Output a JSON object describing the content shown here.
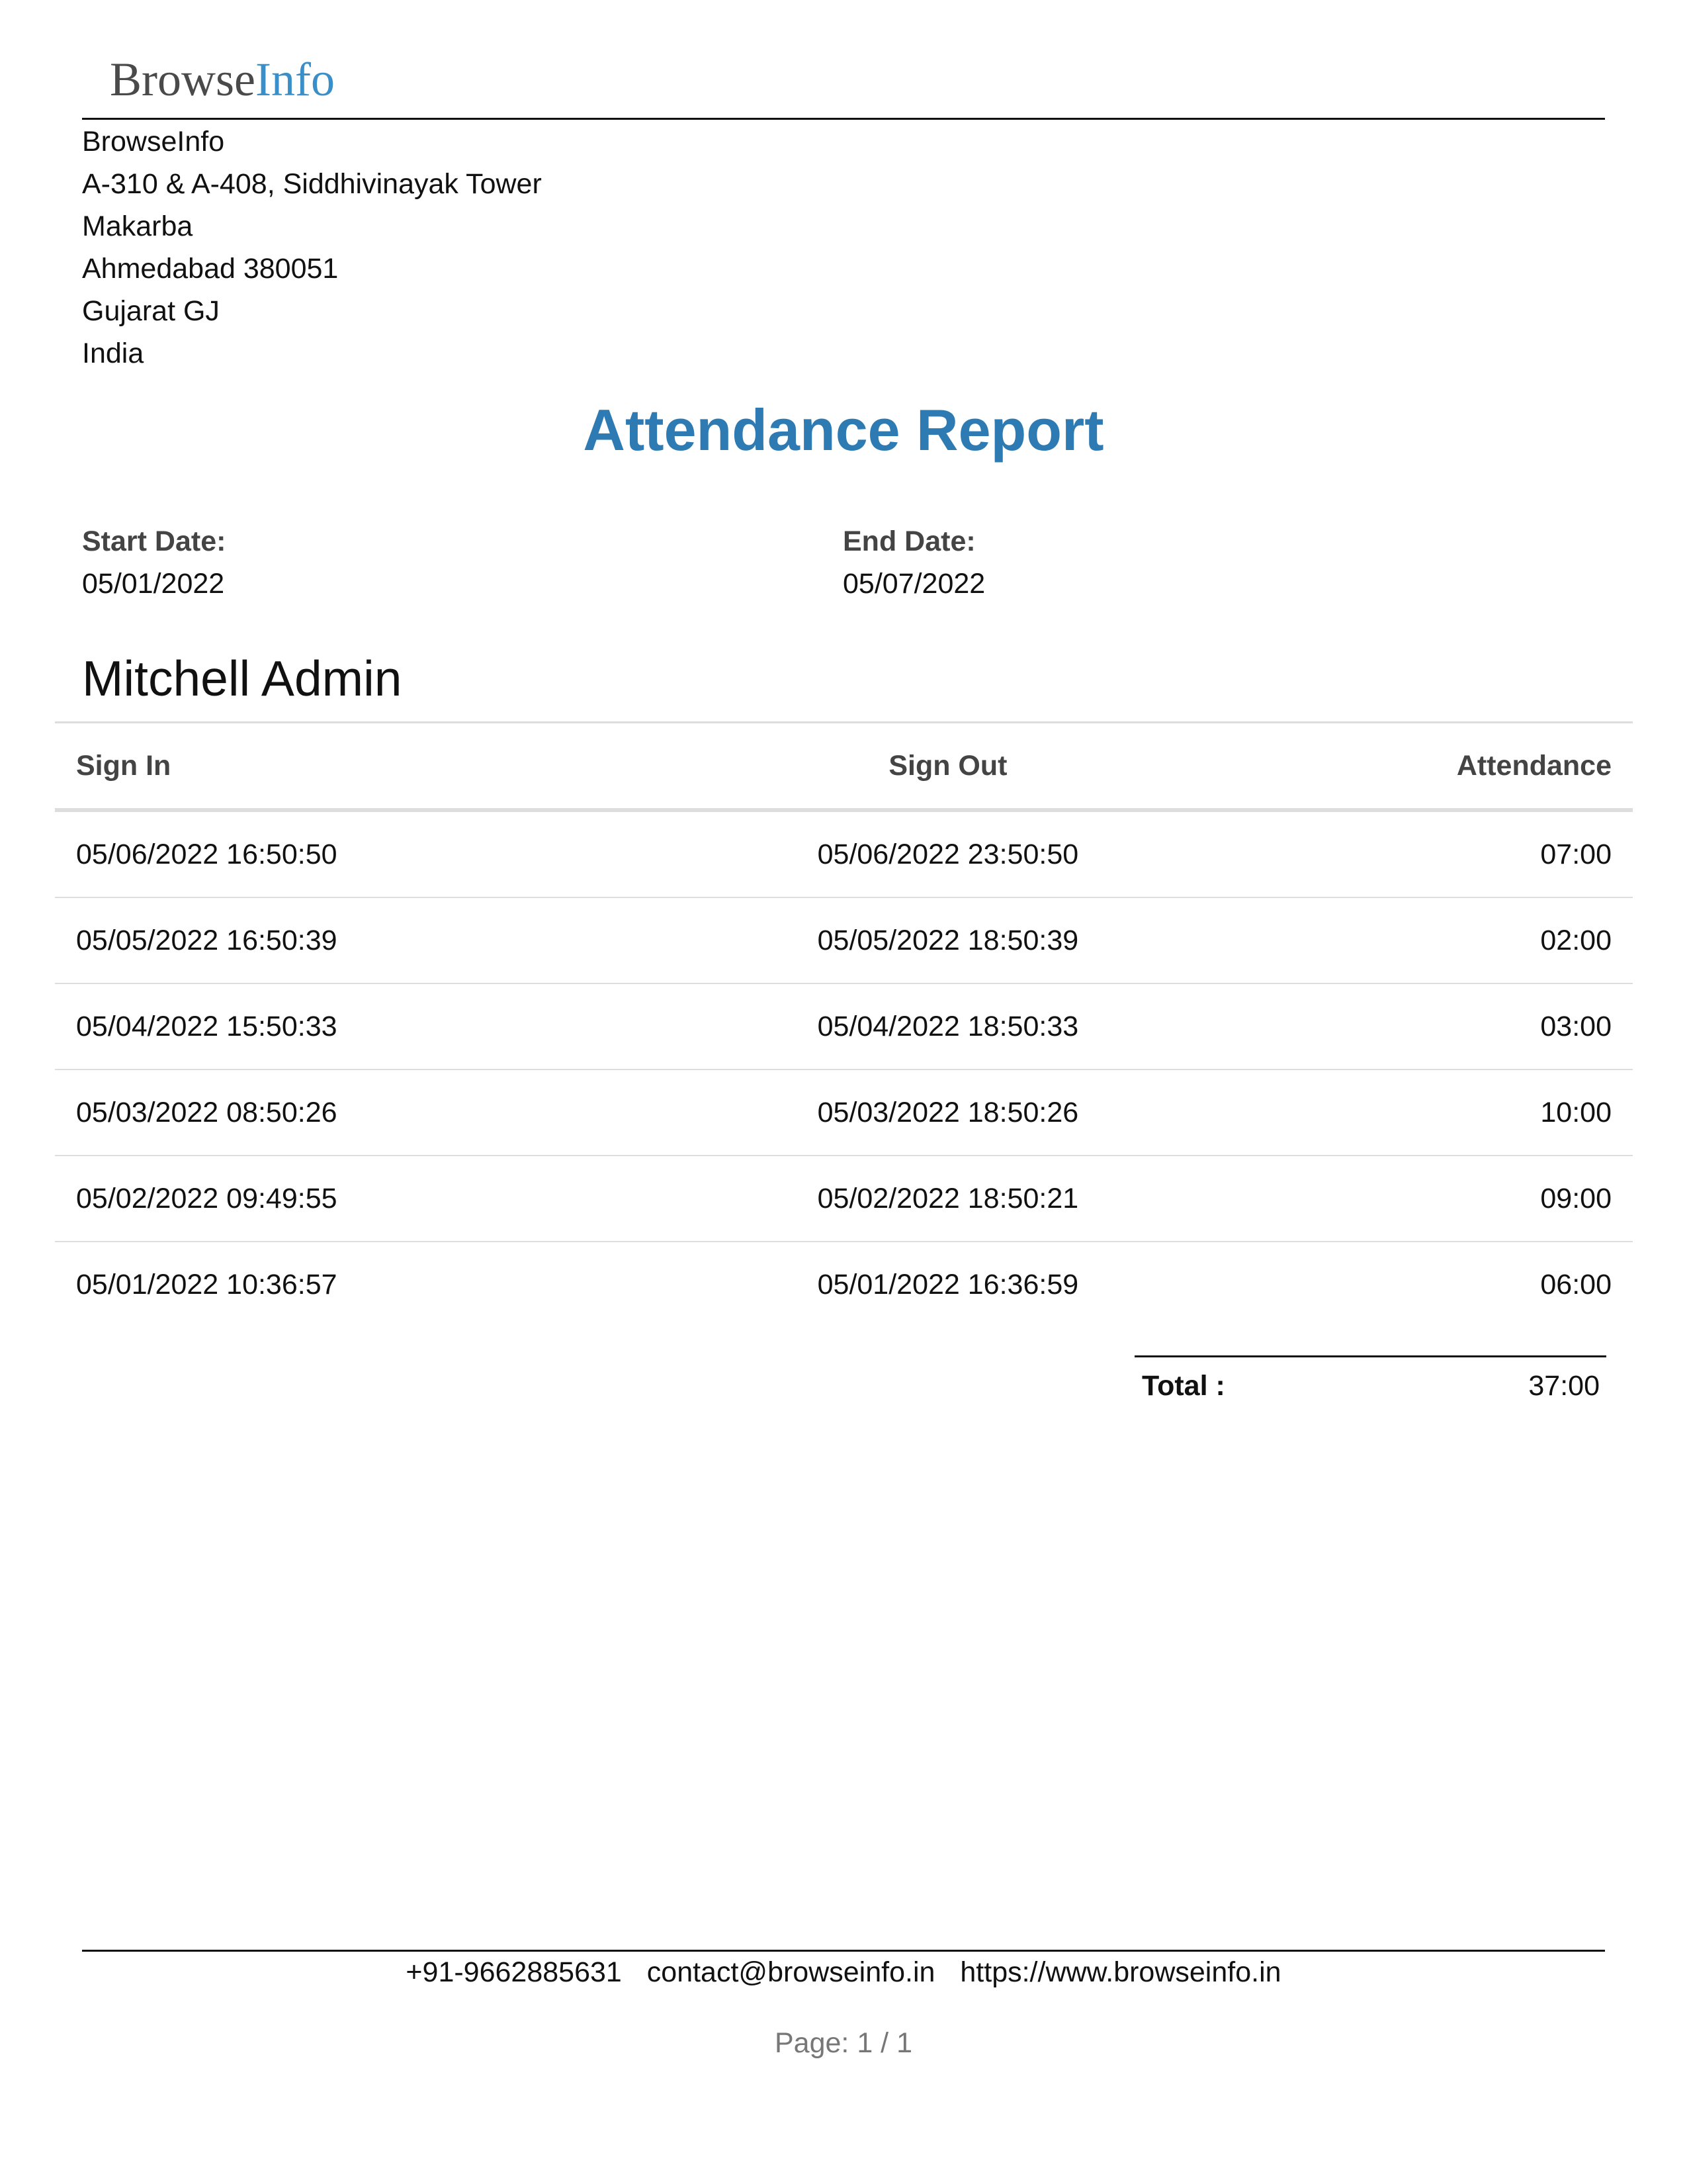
{
  "header": {
    "logo_part1": "Browse",
    "logo_part2": "Info",
    "logo_colors": {
      "part1": "#4a4a4a",
      "part2": "#3a8fc8"
    }
  },
  "company_address": [
    "BrowseInfo",
    "A-310 & A-408, Siddhivinayak Tower",
    "Makarba",
    "Ahmedabad 380051",
    "Gujarat GJ",
    "India"
  ],
  "report": {
    "title": "Attendance Report",
    "title_color": "#2e7bb4",
    "start_date_label": "Start Date:",
    "start_date": "05/01/2022",
    "end_date_label": "End Date:",
    "end_date": "05/07/2022",
    "employee_name": "Mitchell Admin"
  },
  "table": {
    "headers": [
      "Sign In",
      "Sign Out",
      "Attendance"
    ],
    "rows": [
      [
        "05/06/2022 16:50:50",
        "05/06/2022 23:50:50",
        "07:00"
      ],
      [
        "05/05/2022 16:50:39",
        "05/05/2022 18:50:39",
        "02:00"
      ],
      [
        "05/04/2022 15:50:33",
        "05/04/2022 18:50:33",
        "03:00"
      ],
      [
        "05/03/2022 08:50:26",
        "05/03/2022 18:50:26",
        "10:00"
      ],
      [
        "05/02/2022 09:49:55",
        "05/02/2022 18:50:21",
        "09:00"
      ],
      [
        "05/01/2022 10:36:57",
        "05/01/2022 16:36:59",
        "06:00"
      ]
    ]
  },
  "total": {
    "label": "Total :",
    "value": "37:00"
  },
  "footer": {
    "phone": "+91-9662885631",
    "email": "contact@browseinfo.in",
    "website": "https://www.browseinfo.in",
    "page": "Page: 1 / 1"
  }
}
